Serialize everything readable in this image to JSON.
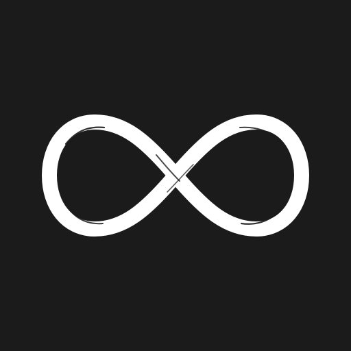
{
  "background": {
    "color": "#1b1b1b"
  },
  "logo": {
    "icon": "infinity-icon",
    "stroke_color": "#ffffff",
    "highlight_color": "#d8d8d8"
  }
}
